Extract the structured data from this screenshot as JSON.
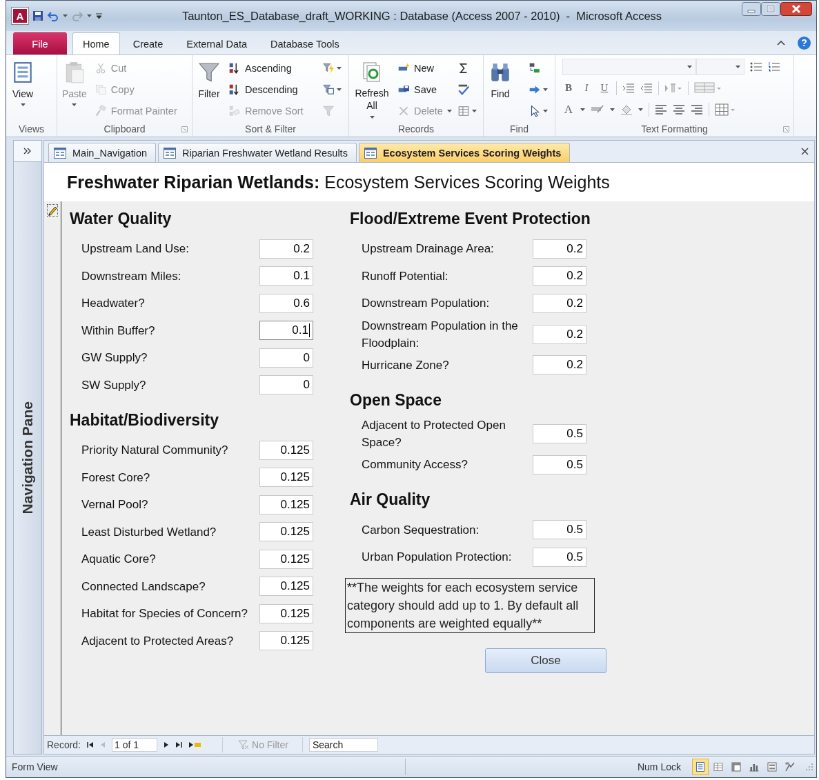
{
  "window": {
    "title": "Taunton_ES_Database_draft_WORKING : Database (Access 2007 - 2010)  -  Microsoft Access",
    "app_icon_letter": "A"
  },
  "ribbon_tabs": [
    {
      "label": "File",
      "kind": "backstage",
      "selected": false
    },
    {
      "label": "Home",
      "kind": "tab",
      "selected": true
    },
    {
      "label": "Create",
      "kind": "tab",
      "selected": false
    },
    {
      "label": "External Data",
      "kind": "tab",
      "selected": false
    },
    {
      "label": "Database Tools",
      "kind": "tab",
      "selected": false
    }
  ],
  "help_glyph": "?",
  "ribbon": {
    "groups": [
      {
        "label": "Views",
        "kind": "buttons",
        "launcher": false,
        "large": [
          {
            "label": "View",
            "disabled": false,
            "dropdown": true
          }
        ]
      },
      {
        "label": "Clipboard",
        "kind": "buttons",
        "launcher": true,
        "large": [
          {
            "label": "Paste",
            "disabled": true,
            "dropdown": true
          }
        ],
        "small": [
          {
            "label": "Cut",
            "disabled": true,
            "dropdown": false
          },
          {
            "label": "Copy",
            "disabled": true,
            "dropdown": false
          },
          {
            "label": "Format Painter",
            "disabled": true,
            "dropdown": false
          }
        ]
      },
      {
        "label": "Sort & Filter",
        "kind": "buttons",
        "launcher": false,
        "large": [
          {
            "label": "Filter",
            "disabled": false,
            "dropdown": false
          }
        ],
        "small": [
          {
            "label": "Ascending",
            "disabled": false,
            "dropdown": false
          },
          {
            "label": "Descending",
            "disabled": false,
            "dropdown": false
          },
          {
            "label": "Remove Sort",
            "disabled": true,
            "dropdown": false
          }
        ]
      },
      {
        "label": "Records",
        "kind": "buttons",
        "launcher": false,
        "large": [
          {
            "label": "Refresh All",
            "disabled": false,
            "dropdown": true
          }
        ],
        "small": [
          {
            "label": "New",
            "disabled": false,
            "dropdown": false
          },
          {
            "label": "Save",
            "disabled": false,
            "dropdown": false
          },
          {
            "label": "Delete",
            "disabled": true,
            "dropdown": true
          }
        ]
      },
      {
        "label": "Find",
        "kind": "buttons",
        "launcher": false,
        "large": [
          {
            "label": "Find",
            "disabled": false,
            "dropdown": false
          }
        ]
      },
      {
        "label": "Text Formatting",
        "kind": "formatting",
        "launcher": true,
        "glyphs": [
          "B",
          "I",
          "U",
          "A"
        ]
      }
    ]
  },
  "document_tabs": [
    {
      "label": "Main_Navigation",
      "selected": false
    },
    {
      "label": "Riparian Freshwater Wetland Results",
      "selected": false
    },
    {
      "label": "Ecosystem Services Scoring Weights",
      "selected": true
    }
  ],
  "navigation_pane": {
    "label": "Navigation Pane"
  },
  "form": {
    "title": "**Freshwater Riparian Wetlands:**  Ecosystem Services Scoring Weights",
    "columns": [
      [
        {
          "title": "Water Quality",
          "rows": [
            {
              "label": "Upstream Land Use:",
              "value": "0.2",
              "focused": false
            },
            {
              "label": "Downstream Miles:",
              "value": "0.1",
              "focused": false
            },
            {
              "label": "Headwater?",
              "value": "0.6",
              "focused": false
            },
            {
              "label": "Within Buffer?",
              "value": "0.1",
              "focused": true
            },
            {
              "label": "GW Supply?",
              "value": "0",
              "focused": false
            },
            {
              "label": "SW Supply?",
              "value": "0",
              "focused": false
            }
          ]
        },
        {
          "title": "Habitat/Biodiversity",
          "rows": [
            {
              "label": "Priority Natural Community?",
              "value": "0.125",
              "focused": false
            },
            {
              "label": "Forest Core?",
              "value": "0.125",
              "focused": false
            },
            {
              "label": "Vernal Pool?",
              "value": "0.125",
              "focused": false
            },
            {
              "label": "Least Disturbed Wetland?",
              "value": "0.125",
              "focused": false
            },
            {
              "label": "Aquatic Core?",
              "value": "0.125",
              "focused": false
            },
            {
              "label": "Connected Landscape?",
              "value": "0.125",
              "focused": false
            },
            {
              "label": "Habitat for Species of Concern?",
              "value": "0.125",
              "focused": false
            },
            {
              "label": "Adjacent to Protected Areas?",
              "value": "0.125",
              "focused": false
            }
          ]
        }
      ],
      [
        {
          "title": "Flood/Extreme Event Protection",
          "rows": [
            {
              "label": "Upstream Drainage Area:",
              "value": "0.2",
              "focused": false
            },
            {
              "label": "Runoff Potential:",
              "value": "0.2",
              "focused": false
            },
            {
              "label": "Downstream Population:",
              "value": "0.2",
              "focused": false
            },
            {
              "label": "Downstream Population in the Floodplain:",
              "value": "0.2",
              "focused": false
            },
            {
              "label": "Hurricane Zone?",
              "value": "0.2",
              "focused": false
            }
          ]
        },
        {
          "title": "Open Space",
          "rows": [
            {
              "label": "Adjacent to Protected Open Space?",
              "value": "0.5",
              "focused": false
            },
            {
              "label": "Community Access?",
              "value": "0.5",
              "focused": false
            }
          ]
        },
        {
          "title": "Air Quality",
          "rows": [
            {
              "label": "Carbon Sequestration:",
              "value": "0.5",
              "focused": false
            },
            {
              "label": "Urban Population Protection:",
              "value": "0.5",
              "focused": false
            }
          ]
        }
      ]
    ],
    "note": "**The weights for each ecosystem service category should add up to 1. By default all components are weighted equally**",
    "close_button": "Close"
  },
  "record_navigator": {
    "label": "Record:",
    "position": "1 of 1",
    "filter": "No Filter",
    "filter_active": false,
    "search_placeholder": "Search"
  },
  "status_bar": {
    "mode": "Form View",
    "num_lock": "Num Lock",
    "views": [
      {
        "selected": true
      },
      {
        "selected": false
      },
      {
        "selected": false
      },
      {
        "selected": false
      },
      {
        "selected": false
      },
      {
        "selected": false
      }
    ]
  }
}
